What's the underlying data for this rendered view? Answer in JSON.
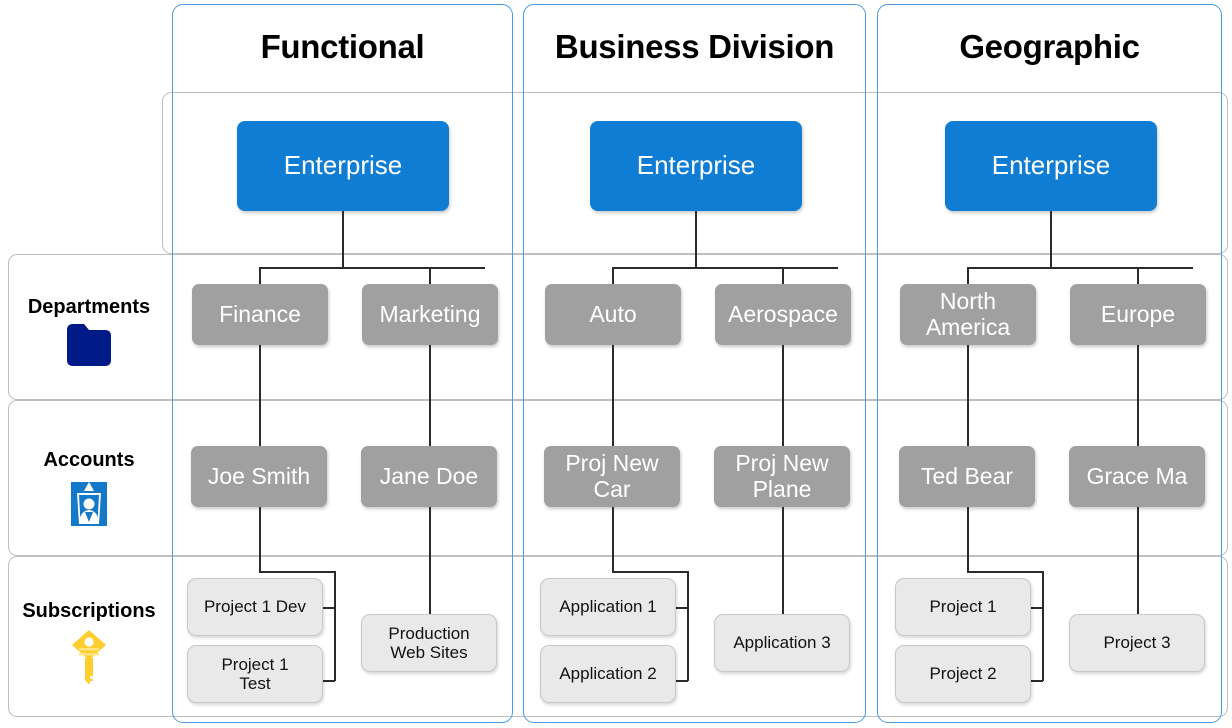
{
  "columns": [
    {
      "title": "Functional"
    },
    {
      "title": "Business Division"
    },
    {
      "title": "Geographic"
    }
  ],
  "tiers": [
    {
      "label": "Departments",
      "icon": "folder-icon"
    },
    {
      "label": "Accounts",
      "icon": "id-badge-icon"
    },
    {
      "label": "Subscriptions",
      "icon": "key-icon"
    }
  ],
  "enterprise": [
    {
      "label": "Enterprise"
    },
    {
      "label": "Enterprise"
    },
    {
      "label": "Enterprise"
    }
  ],
  "departments": [
    {
      "label": "Finance"
    },
    {
      "label": "Marketing"
    },
    {
      "label": "Auto"
    },
    {
      "label": "Aerospace"
    },
    {
      "label": "North\nAmerica"
    },
    {
      "label": "Europe"
    }
  ],
  "accounts": [
    {
      "label": "Joe Smith"
    },
    {
      "label": "Jane Doe"
    },
    {
      "label": "Proj New\nCar"
    },
    {
      "label": "Proj New\nPlane"
    },
    {
      "label": "Ted Bear"
    },
    {
      "label": "Grace Ma"
    }
  ],
  "subscriptions": [
    {
      "label": "Project 1 Dev"
    },
    {
      "label": "Project 1\nTest"
    },
    {
      "label": "Production\nWeb Sites"
    },
    {
      "label": "Application 1"
    },
    {
      "label": "Application 2"
    },
    {
      "label": "Application 3"
    },
    {
      "label": "Project 1"
    },
    {
      "label": "Project 2"
    },
    {
      "label": "Project 3"
    }
  ],
  "colors": {
    "enterprise_fill": "#0F7DD4",
    "mid_fill": "#A0A0A0",
    "leaf_fill": "#E9E9E9",
    "panel_border": "#4B9CE2",
    "tier_border": "#BFBFBF",
    "connector": "#2B2B2B",
    "folder_icon": "#001A87",
    "badge_icon": "#1479C9",
    "key_icon": "#FFCE2E"
  }
}
